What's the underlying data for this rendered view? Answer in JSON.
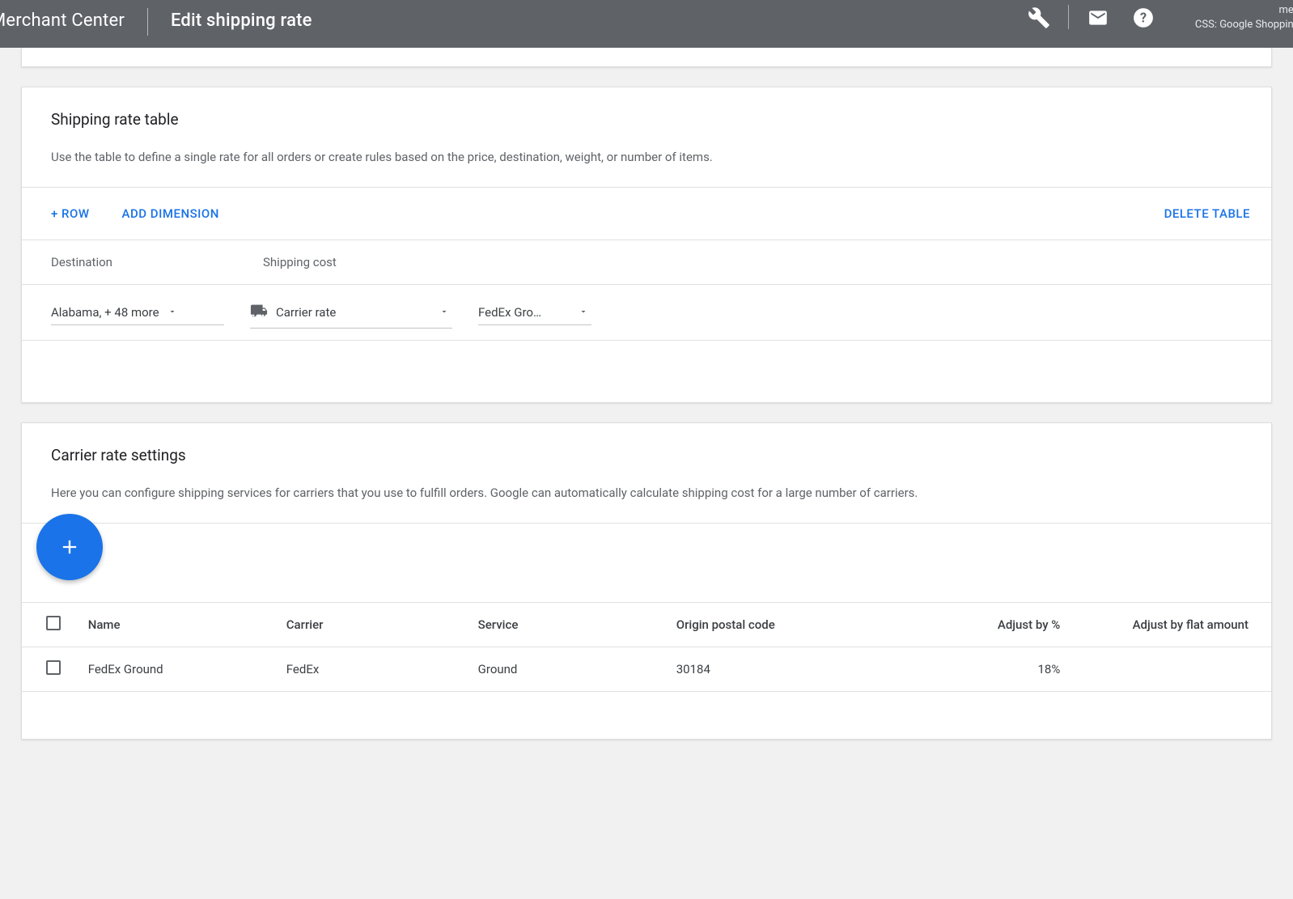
{
  "header": {
    "brand": "Merchant Center",
    "title": "Edit shipping rate",
    "account_line1": "men",
    "account_line2": "CSS: Google Shopping"
  },
  "rate_table": {
    "title": "Shipping rate table",
    "description": "Use the table to define a single rate for all orders or create rules based on the price, destination, weight, or number of items.",
    "actions": {
      "add_row": "+ ROW",
      "add_dimension": "ADD DIMENSION",
      "delete_table": "DELETE TABLE"
    },
    "col_destination": "Destination",
    "col_shipping_cost": "Shipping cost",
    "row": {
      "destination": "Alabama, + 48 more",
      "rate_type": "Carrier rate",
      "carrier_service": "FedEx Gro…"
    }
  },
  "carrier_settings": {
    "title": "Carrier rate settings",
    "description": "Here you can configure shipping services for carriers that you use to fulfill orders. Google can automatically calculate shipping cost for a large number of carriers.",
    "columns": {
      "name": "Name",
      "carrier": "Carrier",
      "service": "Service",
      "origin_postal": "Origin postal code",
      "adjust_pct": "Adjust by %",
      "adjust_flat": "Adjust by flat amount"
    },
    "rows": [
      {
        "name": "FedEx Ground",
        "carrier": "FedEx",
        "service": "Ground",
        "origin_postal": "30184",
        "adjust_pct": "18%",
        "adjust_flat": ""
      }
    ]
  }
}
